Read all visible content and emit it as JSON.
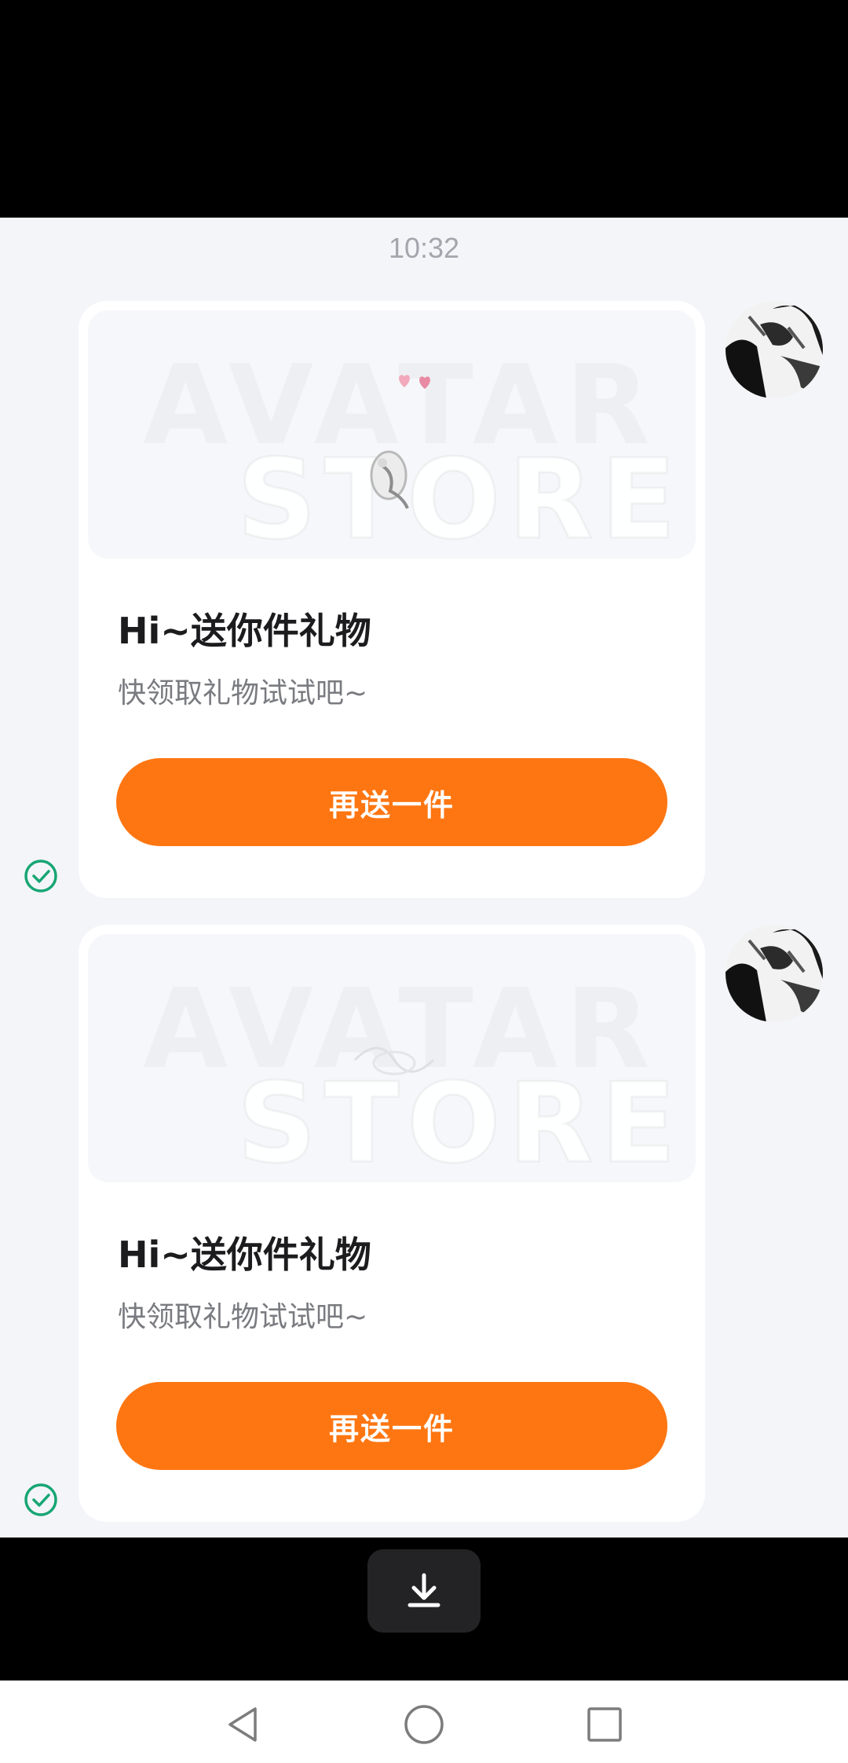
{
  "chat": {
    "timestamp": "10:32",
    "messages": [
      {
        "title": "Hi~送你件礼物",
        "subtitle": "快领取礼物试试吧~",
        "button_label": "再送一件",
        "watermark": [
          "AVATAR",
          "STORE"
        ],
        "status": "sent"
      },
      {
        "title": "Hi~送你件礼物",
        "subtitle": "快领取礼物试试吧~",
        "button_label": "再送一件",
        "watermark": [
          "AVATAR",
          "STORE"
        ],
        "status": "sent"
      }
    ]
  },
  "toolbar": {
    "download_icon": "download-icon"
  },
  "navigation": {
    "icons": [
      "back-triangle-icon",
      "home-circle-icon",
      "recents-square-icon"
    ]
  },
  "colors": {
    "accent": "#fe7612",
    "status_check": "#17a673",
    "background": "#f4f5f9"
  }
}
